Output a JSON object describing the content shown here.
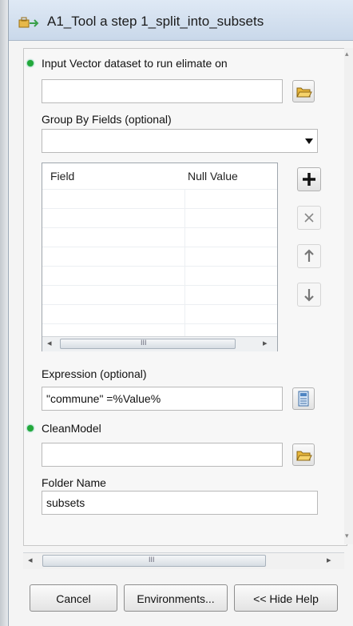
{
  "window": {
    "title": "A1_Tool a step 1_split_into_subsets"
  },
  "form": {
    "input_dataset_label": "Input Vector dataset to run elimate on",
    "input_dataset_value": "",
    "group_by_label": "Group By Fields (optional)",
    "group_by_value": "",
    "table": {
      "columns": [
        "Field",
        "Null Value"
      ],
      "rows": []
    },
    "table_scroll_label": "III",
    "expression_label": "Expression (optional)",
    "expression_value": "\"commune\" =%Value%",
    "clean_model_label": "CleanModel",
    "clean_model_value": "",
    "folder_name_label": "Folder Name",
    "folder_name_value": "subsets"
  },
  "icons": {
    "title": "toolbox-icon",
    "browse": "folder-open-icon",
    "dropdown": "chevron-down-icon",
    "add": "plus-icon",
    "remove": "x-icon",
    "up": "arrow-up-icon",
    "down": "arrow-down-icon",
    "sql": "sql-calculator-icon",
    "required": "green-dot-icon"
  },
  "scrollbar_label": "III",
  "buttons": {
    "cancel": "Cancel",
    "environments": "Environments...",
    "hide_help": "<< Hide Help"
  },
  "colors": {
    "required": "#23a83a",
    "titlebar": "#c9d8ea"
  }
}
